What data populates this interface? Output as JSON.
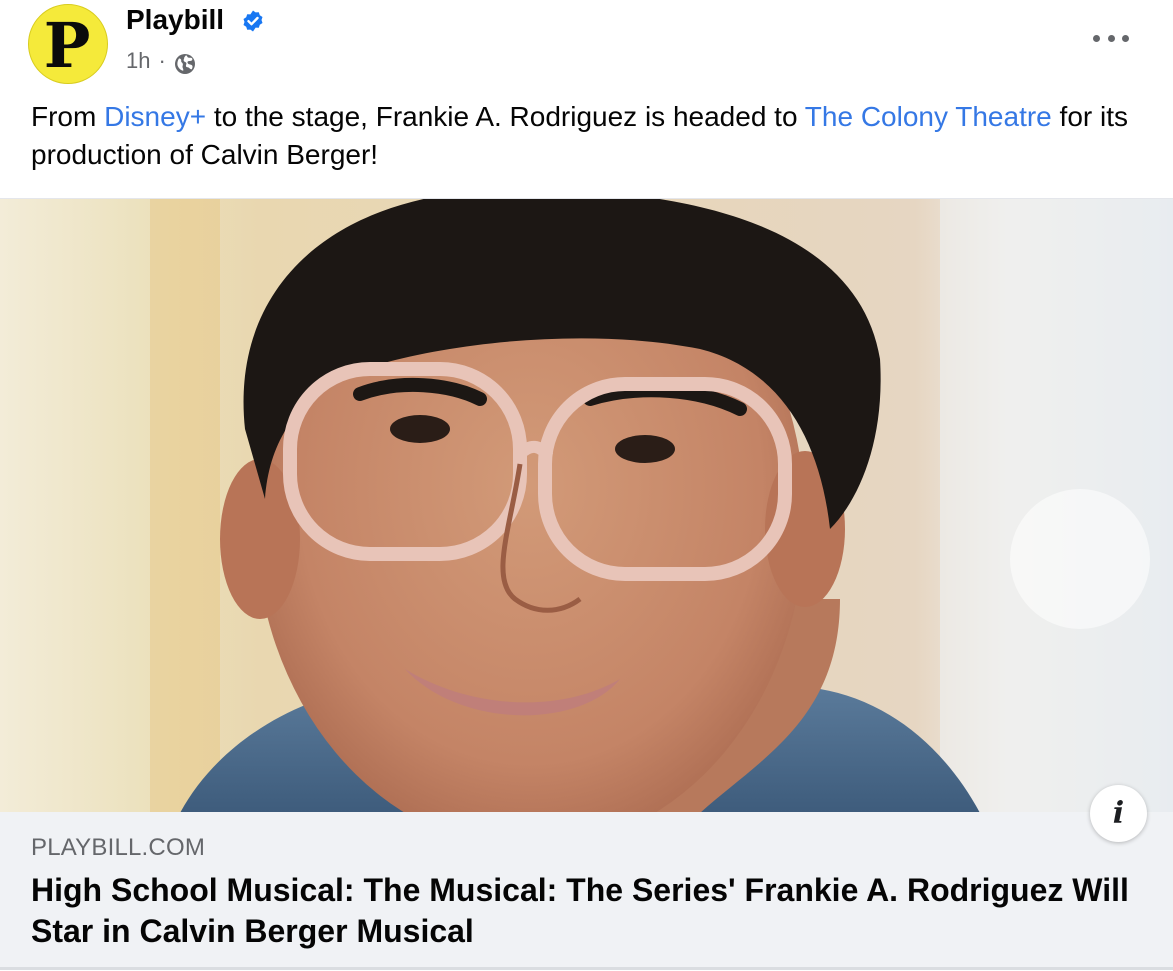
{
  "post": {
    "page_name": "Playbill",
    "avatar_letter": "P",
    "time": "1h",
    "separator": "·",
    "audience_icon": "globe-icon",
    "more_icon": "more-options-icon",
    "verified_icon": "verified-badge-icon",
    "text": {
      "part1": "From ",
      "link1": "Disney+",
      "part2": " to the stage, Frankie A. Rodriguez is headed to ",
      "link2": "The Colony Theatre",
      "part3": " for its production of Calvin Berger!"
    }
  },
  "link_preview": {
    "domain": "PLAYBILL.COM",
    "headline": "High School Musical: The Musical: The Series' Frankie A. Rodriguez Will Star in Calvin Berger Musical",
    "info_icon": "info-icon",
    "info_label": "i"
  },
  "colors": {
    "link": "#3578e5",
    "verified": "#1877f2",
    "avatar_bg": "#f5ea3a",
    "meta_text": "#65676b",
    "card_bg": "#f0f2f5"
  }
}
